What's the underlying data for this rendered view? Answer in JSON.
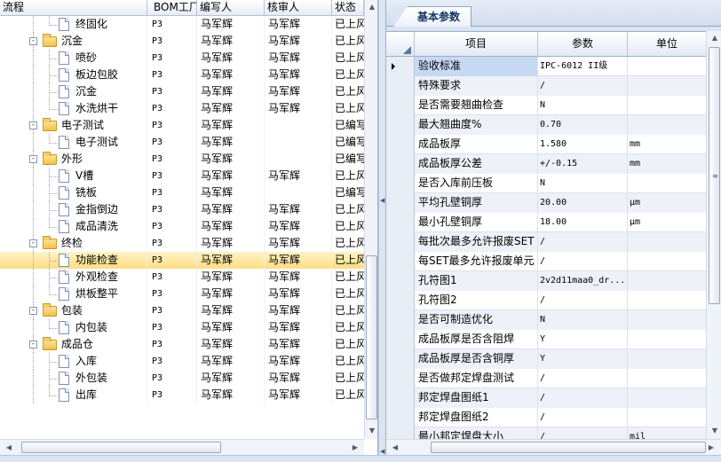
{
  "tree": {
    "columns": [
      "流程",
      "BOM工厂",
      "编写人",
      "核审人",
      "状态"
    ],
    "rows": [
      {
        "name": "终固化",
        "type": "doc",
        "level": 2,
        "bom": "P3",
        "author": "马军辉",
        "reviewer": "马军辉",
        "status": "已上风"
      },
      {
        "name": "沉金",
        "type": "folder",
        "level": 1,
        "bom": "P3",
        "author": "马军辉",
        "reviewer": "马军辉",
        "status": "已上风"
      },
      {
        "name": "喷砂",
        "type": "doc",
        "level": 2,
        "bom": "P3",
        "author": "马军辉",
        "reviewer": "马军辉",
        "status": "已上风"
      },
      {
        "name": "板边包胶",
        "type": "doc",
        "level": 2,
        "bom": "P3",
        "author": "马军辉",
        "reviewer": "马军辉",
        "status": "已上风"
      },
      {
        "name": "沉金",
        "type": "doc",
        "level": 2,
        "bom": "P3",
        "author": "马军辉",
        "reviewer": "马军辉",
        "status": "已上风"
      },
      {
        "name": "水洗烘干",
        "type": "doc",
        "level": 2,
        "bom": "P3",
        "author": "马军辉",
        "reviewer": "马军辉",
        "status": "已上风"
      },
      {
        "name": "电子测试",
        "type": "folder",
        "level": 1,
        "bom": "P3",
        "author": "马军辉",
        "reviewer": "",
        "status": "已编写"
      },
      {
        "name": "电子测试",
        "type": "doc",
        "level": 2,
        "bom": "P3",
        "author": "马军辉",
        "reviewer": "",
        "status": "已编写"
      },
      {
        "name": "外形",
        "type": "folder",
        "level": 1,
        "bom": "P3",
        "author": "马军辉",
        "reviewer": "",
        "status": "已编写"
      },
      {
        "name": "V槽",
        "type": "doc",
        "level": 2,
        "bom": "P3",
        "author": "马军辉",
        "reviewer": "马军辉",
        "status": "已上风"
      },
      {
        "name": "铣板",
        "type": "doc",
        "level": 2,
        "bom": "P3",
        "author": "马军辉",
        "reviewer": "",
        "status": "已编写"
      },
      {
        "name": "金指倒边",
        "type": "doc",
        "level": 2,
        "bom": "P3",
        "author": "马军辉",
        "reviewer": "马军辉",
        "status": "已上风"
      },
      {
        "name": "成品清洗",
        "type": "doc",
        "level": 2,
        "bom": "P3",
        "author": "马军辉",
        "reviewer": "马军辉",
        "status": "已上风"
      },
      {
        "name": "终检",
        "type": "folder",
        "level": 1,
        "bom": "P3",
        "author": "马军辉",
        "reviewer": "马军辉",
        "status": "已上风"
      },
      {
        "name": "功能检查",
        "type": "doc",
        "level": 2,
        "bom": "P3",
        "author": "马军辉",
        "reviewer": "马军辉",
        "status": "已上风",
        "selected": true
      },
      {
        "name": "外观检查",
        "type": "doc",
        "level": 2,
        "bom": "P3",
        "author": "马军辉",
        "reviewer": "马军辉",
        "status": "已上风"
      },
      {
        "name": "烘板整平",
        "type": "doc",
        "level": 2,
        "bom": "P3",
        "author": "马军辉",
        "reviewer": "马军辉",
        "status": "已上风"
      },
      {
        "name": "包装",
        "type": "folder",
        "level": 1,
        "bom": "P3",
        "author": "马军辉",
        "reviewer": "马军辉",
        "status": "已上风"
      },
      {
        "name": "内包装",
        "type": "doc",
        "level": 2,
        "bom": "P3",
        "author": "马军辉",
        "reviewer": "马军辉",
        "status": "已上风"
      },
      {
        "name": "成品仓",
        "type": "folder",
        "level": 1,
        "bom": "P3",
        "author": "马军辉",
        "reviewer": "马军辉",
        "status": "已上风"
      },
      {
        "name": "入库",
        "type": "doc",
        "level": 2,
        "bom": "P3",
        "author": "马军辉",
        "reviewer": "马军辉",
        "status": "已上风"
      },
      {
        "name": "外包装",
        "type": "doc",
        "level": 2,
        "bom": "P3",
        "author": "马军辉",
        "reviewer": "马军辉",
        "status": "已上风"
      },
      {
        "name": "出库",
        "type": "doc",
        "level": 2,
        "bom": "P3",
        "author": "马军辉",
        "reviewer": "马军辉",
        "status": "已上风"
      }
    ]
  },
  "params": {
    "tab_label": "基本参数",
    "columns": {
      "item": "项目",
      "value": "参数",
      "unit": "单位"
    },
    "rows": [
      {
        "item": "验收标准",
        "value": "IPC-6012 II级",
        "unit": "",
        "current": true
      },
      {
        "item": "特殊要求",
        "value": "/",
        "unit": ""
      },
      {
        "item": "是否需要翘曲检查",
        "value": "N",
        "unit": ""
      },
      {
        "item": "最大翘曲度%",
        "value": "0.70",
        "unit": ""
      },
      {
        "item": "成品板厚",
        "value": "1.580",
        "unit": "mm"
      },
      {
        "item": "成品板厚公差",
        "value": "+/-0.15",
        "unit": "mm"
      },
      {
        "item": "是否入库前压板",
        "value": "N",
        "unit": ""
      },
      {
        "item": "平均孔壁铜厚",
        "value": "20.00",
        "unit": "μm"
      },
      {
        "item": "最小孔壁铜厚",
        "value": "18.00",
        "unit": "μm"
      },
      {
        "item": "每批次最多允许报废SET",
        "value": "/",
        "unit": ""
      },
      {
        "item": "每SET最多允许报废单元",
        "value": "/",
        "unit": ""
      },
      {
        "item": "孔符图1",
        "value": "2v2d11maa0_dr...",
        "unit": ""
      },
      {
        "item": "孔符图2",
        "value": "/",
        "unit": ""
      },
      {
        "item": "是否可制造优化",
        "value": "N",
        "unit": ""
      },
      {
        "item": "成品板厚是否含阻焊",
        "value": "Y",
        "unit": ""
      },
      {
        "item": "成品板厚是否含铜厚",
        "value": "Y",
        "unit": ""
      },
      {
        "item": "是否做邦定焊盘测试",
        "value": "/",
        "unit": ""
      },
      {
        "item": "邦定焊盘图纸1",
        "value": "/",
        "unit": ""
      },
      {
        "item": "邦定焊盘图纸2",
        "value": "/",
        "unit": ""
      },
      {
        "item": "最小邦定焊盘大小",
        "value": "/",
        "unit": "mil"
      }
    ]
  },
  "icons": {
    "expanded": "minus-box-icon",
    "folder": "folder-icon",
    "document": "document-icon",
    "row_pointer": "row-pointer-icon"
  },
  "colors": {
    "selection": "#fedd85",
    "current_cell": "#c7d9f2",
    "header": "#e3eaf4"
  }
}
